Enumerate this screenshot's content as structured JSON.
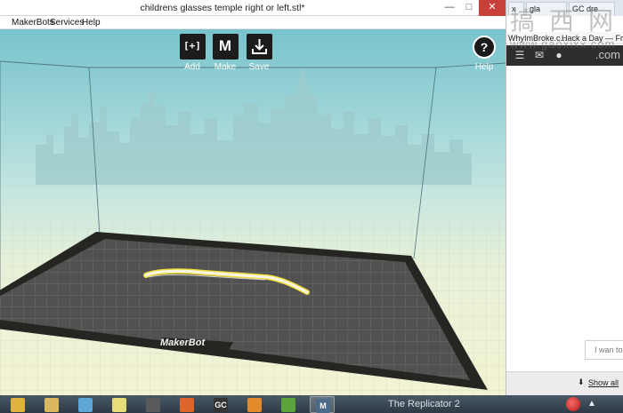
{
  "window": {
    "title": "childrens glasses temple right or left.stl*",
    "controls": {
      "minimize": "—",
      "maximize": "□",
      "close": "✕"
    }
  },
  "menu": [
    "",
    "MakerBots",
    "Services",
    "Help"
  ],
  "toolbar": {
    "add_icon": "[+]",
    "add_label": "Add",
    "make_icon": "M",
    "make_label": "Make",
    "save_label": "Save",
    "help_icon": "?",
    "help_label": "Help"
  },
  "build_plate": {
    "logo_text": "MakerBot"
  },
  "browser": {
    "tabs": [
      "x",
      "gla",
      "GC dre"
    ],
    "bookmarks": [
      "WhyImBroke.c...",
      "Hack a Day — Fres"
    ],
    "google_bar_suffix": ".com",
    "chat_preview": "I wan to",
    "show_all": "Show all",
    "watermark_chars": [
      "搞",
      "西",
      "网"
    ],
    "watermark_url": "www.gaoxixx.com"
  },
  "taskbar": {
    "apps": [
      {
        "name": "chrome-app",
        "color": "#e0b33c",
        "glyph": ""
      },
      {
        "name": "file-manager-app",
        "color": "#d9b860",
        "glyph": ""
      },
      {
        "name": "notepad-app",
        "color": "#5fa7d8",
        "glyph": ""
      },
      {
        "name": "sticky-notes-app",
        "color": "#e6dc7a",
        "glyph": ""
      },
      {
        "name": "cat-app",
        "color": "#5a5a5a",
        "glyph": ""
      },
      {
        "name": "orange-app",
        "color": "#e0652a",
        "glyph": ""
      },
      {
        "name": "gc-app",
        "color": "#333333",
        "glyph": "GC"
      },
      {
        "name": "blender-app",
        "color": "#e38a2d",
        "glyph": ""
      },
      {
        "name": "green-app",
        "color": "#5aa43a",
        "glyph": ""
      },
      {
        "name": "makerbot-app",
        "color": "#4a6b8a",
        "glyph": "M"
      }
    ],
    "tray_text_fragment": "The Replicator 2",
    "tray_right": "▲"
  },
  "colors": {
    "makerbot_yellow": "#f3e24a",
    "plate_dark": "#2a2b27",
    "plate_grid": "#5c5d59"
  }
}
